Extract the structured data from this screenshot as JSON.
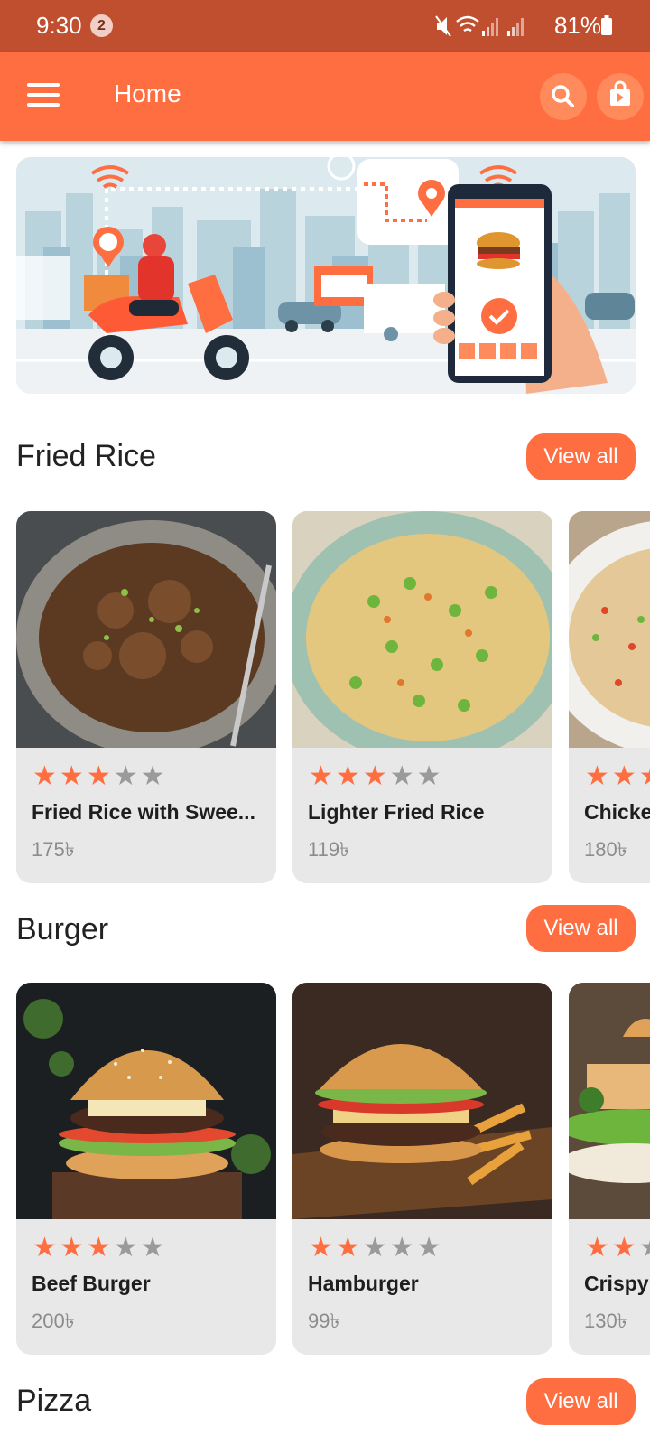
{
  "status_bar": {
    "time": "9:30",
    "notification_count": "2",
    "battery": "81%"
  },
  "app_bar": {
    "title": "Home"
  },
  "sections": [
    {
      "title": "Fried Rice",
      "view_all": "View all",
      "items": [
        {
          "name": "Fried Rice with Swee...",
          "price": "175৳",
          "rating": 3
        },
        {
          "name": "Lighter Fried Rice",
          "price": "119৳",
          "rating": 3
        },
        {
          "name": "Chicke",
          "price": "180৳",
          "rating": 3
        }
      ]
    },
    {
      "title": "Burger",
      "view_all": "View all",
      "items": [
        {
          "name": "Beef Burger",
          "price": "200৳",
          "rating": 3
        },
        {
          "name": "Hamburger",
          "price": "99৳",
          "rating": 2
        },
        {
          "name": "Crispy",
          "price": "130৳",
          "rating": 2
        }
      ]
    },
    {
      "title": "Pizza",
      "view_all": "View all"
    }
  ],
  "colors": {
    "primary": "#ff6e40",
    "status_bar": "#c04f30",
    "card_bg": "#e8e8e8",
    "star_off": "#9a9a9a"
  }
}
